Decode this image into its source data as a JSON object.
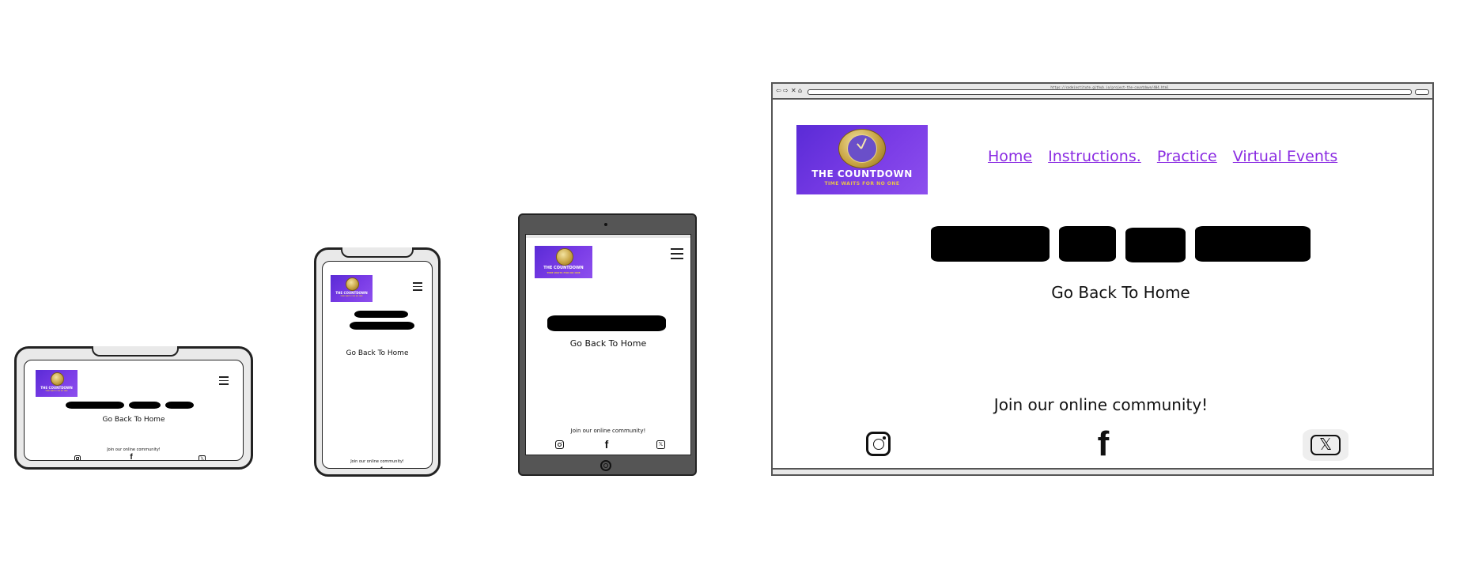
{
  "site": {
    "logo_title": "THE COUNTDOWN",
    "logo_tagline": "TIME WAITS FOR NO ONE",
    "back_home": "Go Back To Home",
    "community": "Join our online community!"
  },
  "nav": {
    "home": "Home",
    "instructions": "Instructions.",
    "practice": "Practice",
    "virtual_events": "Virtual Events"
  },
  "browser": {
    "url": "https://codeinstitute.github.io/project-the-countdown/404.html"
  },
  "social_icons": [
    "instagram-icon",
    "facebook-icon",
    "x-icon"
  ],
  "colors": {
    "logo_purple": "#6a35de",
    "logo_gold": "#c9a545",
    "link_purple": "#8a2be2"
  }
}
